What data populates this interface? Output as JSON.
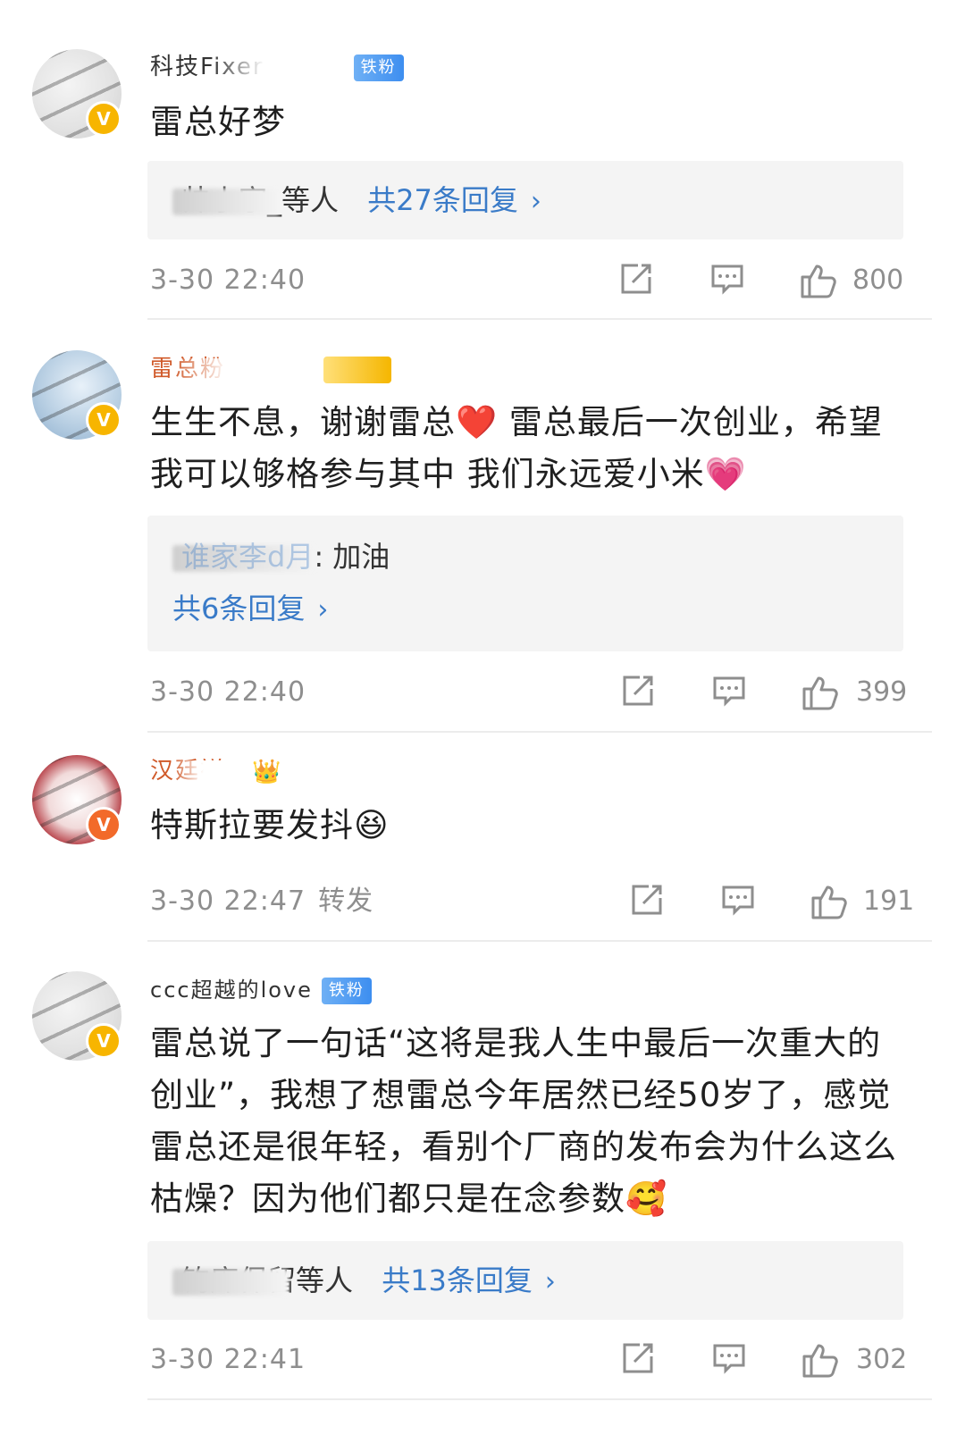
{
  "comments": [
    {
      "username": "科技Fixer",
      "tag": "铁粉",
      "text": "雷总好梦",
      "reply_summary": {
        "names": "帅小宇_等人",
        "count_label": "共27条回复"
      },
      "time": "3-30 22:40",
      "likes": "800"
    },
    {
      "username": "雷总粉",
      "tag": "",
      "text": "生生不息，谢谢雷总❤️ 雷总最后一次创业，希望我可以够格参与其中 我们永远爱小米💗",
      "reply_preview": {
        "author": "谁家李d月",
        "text": ": 加油",
        "count_label": "共6条回复"
      },
      "time": "3-30 22:40",
      "likes": "399"
    },
    {
      "username": "汉廷祥",
      "tag": "",
      "text": "特斯拉要发抖😆",
      "time": "3-30 22:47",
      "forward_label": "转发",
      "likes": "191"
    },
    {
      "username": "ccc超越的love",
      "tag": "铁粉",
      "text": "雷总说了一句话“这将是我人生中最后一次重大的创业”，我想了想雷总今年居然已经50岁了，感觉雷总还是很年轻，看别个厂商的发布会为什么这么枯燥？因为他们都只是在念参数🥰",
      "reply_summary": {
        "names": "钓库保留等人",
        "count_label": "共13条回复"
      },
      "time": "3-30 22:41",
      "likes": "302"
    }
  ],
  "icons": {
    "share": "share-icon",
    "comment": "comment-icon",
    "like": "thumbs-up-icon",
    "verified": "verified-badge-icon"
  },
  "colors": {
    "link": "#3a7bc8",
    "meta": "#8e8e8e",
    "reply_bg": "#f4f4f4",
    "badge_gold": "#f7b500"
  }
}
